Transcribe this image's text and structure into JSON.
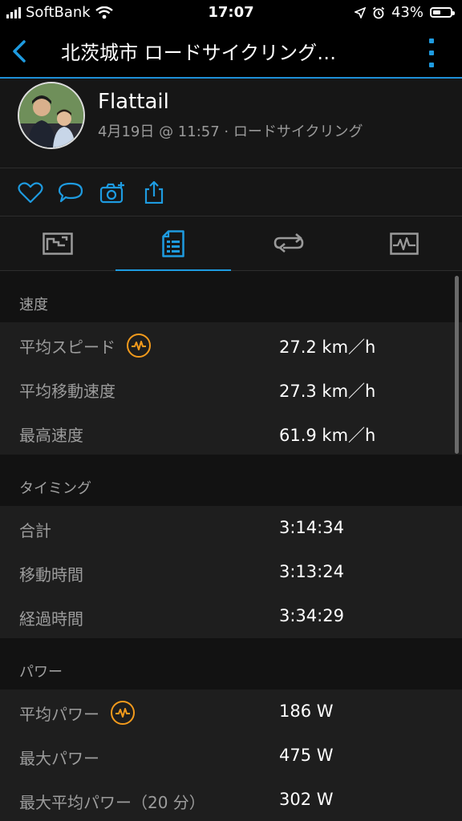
{
  "status_bar": {
    "carrier": "SoftBank",
    "time": "17:07",
    "battery": "43%",
    "battery_level": 0.43
  },
  "nav": {
    "title": "北茨城市 ロードサイクリング…"
  },
  "header": {
    "username": "Flattail",
    "meta": "4月19日 @ 11:57 · ロードサイクリング"
  },
  "icons": {
    "like": "heart-icon",
    "comment": "comment-icon",
    "photo": "add-photo-icon",
    "share": "share-icon"
  },
  "tabs": [
    {
      "name": "overview-tab",
      "icon": "map-icon"
    },
    {
      "name": "stats-tab",
      "icon": "stats-list-icon",
      "active": true
    },
    {
      "name": "laps-tab",
      "icon": "laps-icon"
    },
    {
      "name": "charts-tab",
      "icon": "chart-icon"
    }
  ],
  "sections": [
    {
      "title": "速度",
      "rows": [
        {
          "label": "平均スピード",
          "value": "27.2 km／h",
          "badge": true
        },
        {
          "label": "平均移動速度",
          "value": "27.3 km／h"
        },
        {
          "label": "最高速度",
          "value": "61.9 km／h"
        }
      ]
    },
    {
      "title": "タイミング",
      "rows": [
        {
          "label": "合計",
          "value": "3:14:34"
        },
        {
          "label": "移動時間",
          "value": "3:13:24"
        },
        {
          "label": "経過時間",
          "value": "3:34:29"
        }
      ]
    },
    {
      "title": "パワー",
      "rows": [
        {
          "label": "平均パワー",
          "value": "186 W",
          "badge": true
        },
        {
          "label": "最大パワー",
          "value": "475 W"
        },
        {
          "label": "最大平均パワー（20 分）",
          "value": "302 W"
        }
      ]
    }
  ],
  "colors": {
    "accent": "#1e9be0",
    "badge": "#f29a1c",
    "background": "#121212",
    "row_background": "#1e1e1e",
    "label": "#9c9c9c"
  }
}
